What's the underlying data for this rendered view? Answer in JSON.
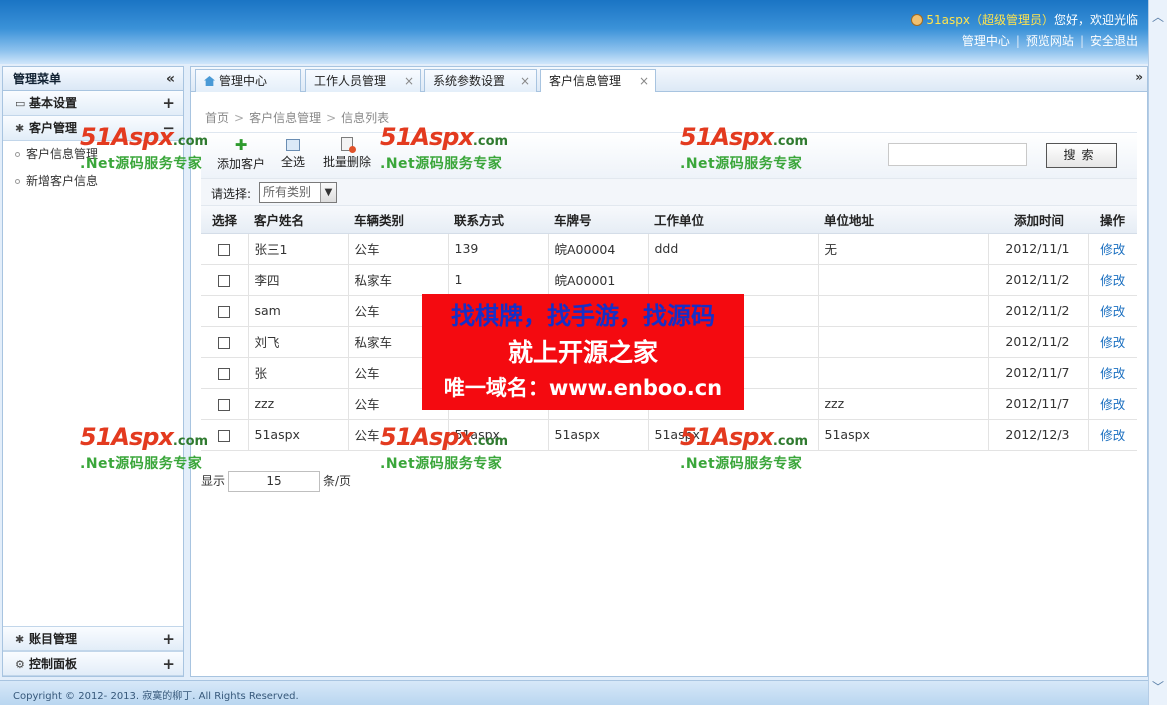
{
  "header": {
    "username": "51aspx",
    "role": "（超级管理员）",
    "greeting": "您好，欢迎光临",
    "links": [
      "管理中心",
      "预览网站",
      "安全退出"
    ]
  },
  "sidebar": {
    "title": "管理菜单",
    "collapse_glyph": "«",
    "groups": [
      {
        "label": "基本设置",
        "icon": "monitor-icon",
        "toggle": "+"
      },
      {
        "label": "客户管理",
        "icon": "gear-icon",
        "toggle": "−",
        "items": [
          "客户信息管理",
          "新增客户信息"
        ]
      },
      {
        "label": "账目管理",
        "icon": "gear-icon",
        "toggle": "+"
      },
      {
        "label": "控制面板",
        "icon": "gear-icon",
        "toggle": "+"
      }
    ]
  },
  "tabs": [
    {
      "label": "管理中心",
      "icon": "home-icon"
    },
    {
      "label": "工作人员管理"
    },
    {
      "label": "系统参数设置"
    },
    {
      "label": "客户信息管理",
      "active": true
    }
  ],
  "breadcrumb": [
    "首页",
    "客户信息管理",
    "信息列表"
  ],
  "toolbar": {
    "add_label": "添加客户",
    "select_all_label": "全选",
    "batch_delete_label": "批量删除",
    "search_value": "",
    "search_button": "搜索"
  },
  "filter": {
    "label": "请选择:",
    "selected": "所有类别"
  },
  "table": {
    "headers": [
      "选择",
      "客户姓名",
      "车辆类别",
      "联系方式",
      "车牌号",
      "工作单位",
      "单位地址",
      "添加时间",
      "操作"
    ],
    "rows": [
      [
        "张三1",
        "公车",
        "139",
        "皖A00004",
        "ddd",
        "无",
        "2012/11/1",
        "修改"
      ],
      [
        "李四",
        "私家车",
        "1",
        "皖A00001",
        "",
        "",
        "2012/11/2",
        "修改"
      ],
      [
        "sam",
        "公车",
        "",
        "",
        "",
        "",
        "2012/11/2",
        "修改"
      ],
      [
        "刘飞",
        "私家车",
        "",
        "",
        "",
        "",
        "2012/11/2",
        "修改"
      ],
      [
        "张",
        "公车",
        "",
        "",
        "",
        "",
        "2012/11/7",
        "修改"
      ],
      [
        "zzz",
        "公车",
        "",
        "",
        "",
        "zzz",
        "2012/11/7",
        "修改"
      ],
      [
        "51aspx",
        "公车",
        "51aspx",
        "51aspx",
        "51aspx",
        "51aspx",
        "2012/12/3",
        "修改"
      ]
    ]
  },
  "pager": {
    "prefix": "显示",
    "page_size": "15",
    "suffix": "条/页"
  },
  "footer": {
    "copyright": "Copyright © 2012- 2013. 寂寞的柳丁. All Rights Reserved."
  },
  "watermark": {
    "logo": "51Aspx",
    "domain": ".com",
    "tagline": ".Net源码服务专家"
  },
  "promo": {
    "line1": "找棋牌，找手游，找源码",
    "line2": "就上开源之家",
    "line3": "唯一域名：www.enboo.cn"
  },
  "colors": {
    "header_blue": "#1a74c4",
    "link_blue": "#1a6fc0",
    "promo_red": "#f40a10",
    "promo_blue": "#1530c8",
    "watermark_red": "#e33a1f",
    "watermark_green": "#3aa63a"
  }
}
